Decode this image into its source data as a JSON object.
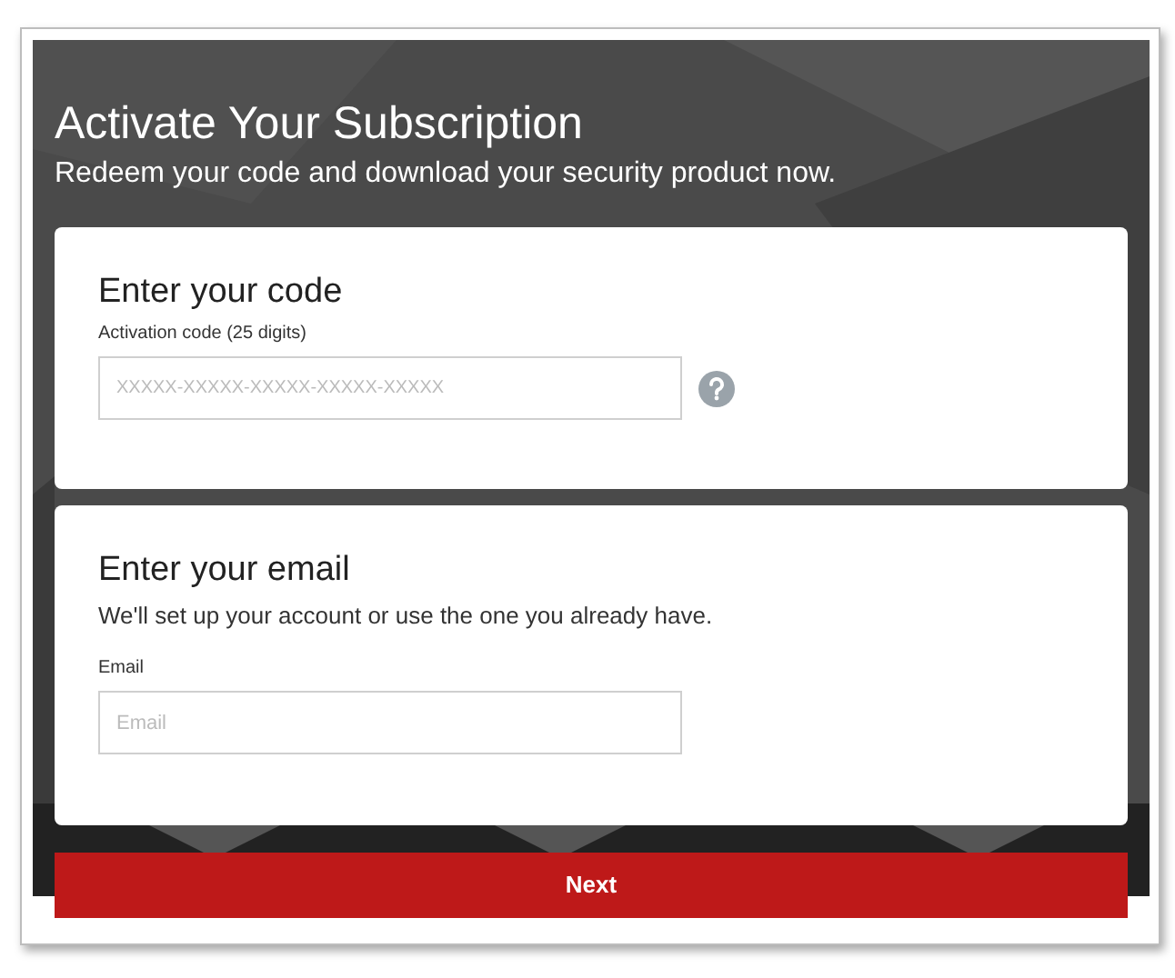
{
  "header": {
    "title": "Activate Your Subscription",
    "subtitle": "Redeem your code and download your security product now."
  },
  "code_card": {
    "heading": "Enter your code",
    "label": "Activation code (25 digits)",
    "placeholder": "XXXXX-XXXXX-XXXXX-XXXXX-XXXXX"
  },
  "email_card": {
    "heading": "Enter your email",
    "description": "We'll set up your account or use the one you already have.",
    "label": "Email",
    "placeholder": "Email"
  },
  "next_button": "Next"
}
